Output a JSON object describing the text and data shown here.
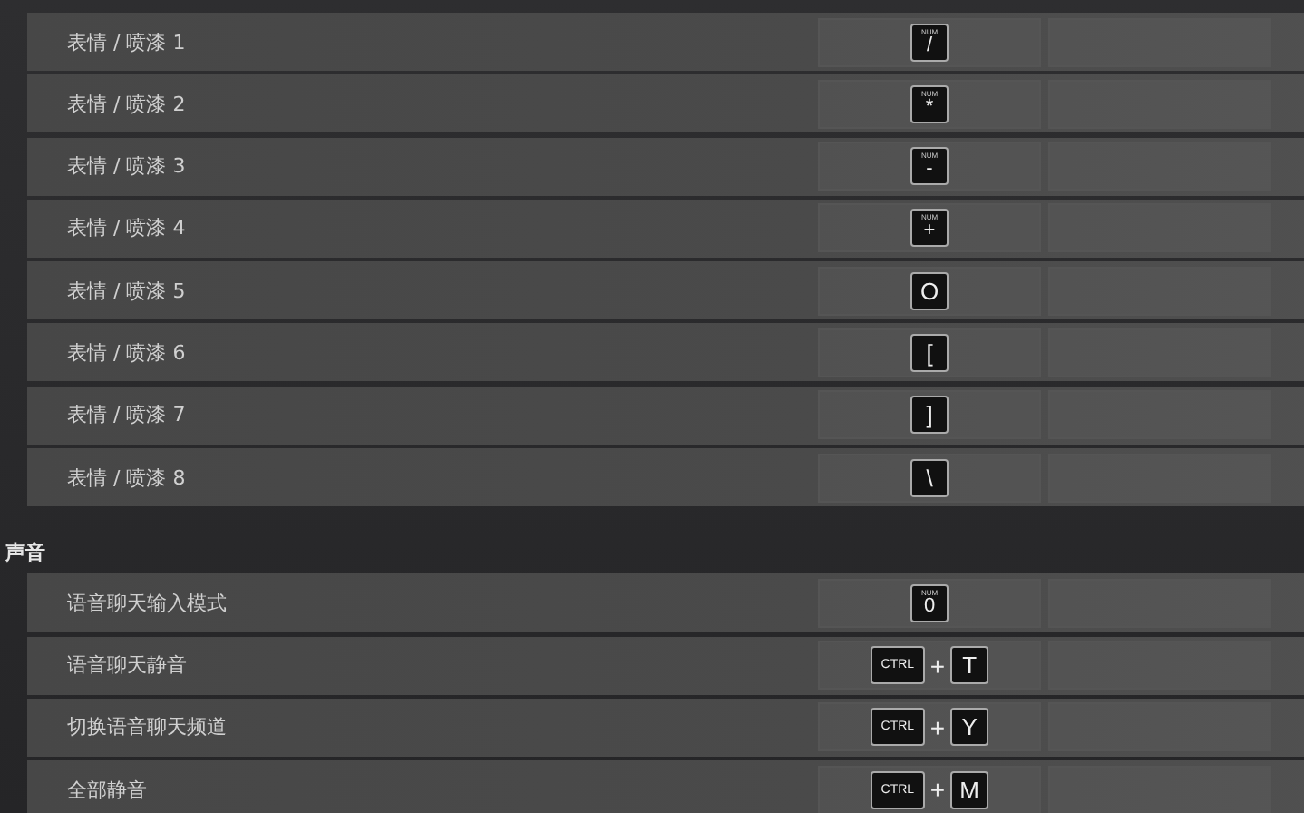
{
  "sections": [
    {
      "rows": [
        {
          "label": "表情 / 喷漆 1",
          "keys": [
            {
              "kind": "num",
              "top": "NUM",
              "label": "/"
            }
          ]
        },
        {
          "label": "表情 / 喷漆 2",
          "keys": [
            {
              "kind": "num",
              "top": "NUM",
              "label": "*"
            }
          ]
        },
        {
          "label": "表情 / 喷漆 3",
          "keys": [
            {
              "kind": "num",
              "top": "NUM",
              "label": "-"
            }
          ]
        },
        {
          "label": "表情 / 喷漆 4",
          "keys": [
            {
              "kind": "num",
              "top": "NUM",
              "label": "+"
            }
          ]
        },
        {
          "label": "表情 / 喷漆 5",
          "keys": [
            {
              "kind": "key",
              "label": "O"
            }
          ]
        },
        {
          "label": "表情 / 喷漆 6",
          "keys": [
            {
              "kind": "key",
              "label": "["
            }
          ]
        },
        {
          "label": "表情 / 喷漆 7",
          "keys": [
            {
              "kind": "key",
              "label": "]"
            }
          ]
        },
        {
          "label": "表情 / 喷漆 8",
          "keys": [
            {
              "kind": "key",
              "label": "\\"
            }
          ]
        }
      ]
    },
    {
      "title": "声音",
      "rows": [
        {
          "label": "语音聊天输入模式",
          "keys": [
            {
              "kind": "num",
              "top": "NUM",
              "label": "0"
            }
          ]
        },
        {
          "label": "语音聊天静音",
          "keys": [
            {
              "kind": "mod",
              "label": "CTRL"
            },
            {
              "kind": "plus",
              "label": "+"
            },
            {
              "kind": "key",
              "label": "T"
            }
          ]
        },
        {
          "label": "切换语音聊天频道",
          "keys": [
            {
              "kind": "mod",
              "label": "CTRL"
            },
            {
              "kind": "plus",
              "label": "+"
            },
            {
              "kind": "key",
              "label": "Y"
            }
          ]
        },
        {
          "label": "全部静音",
          "keys": [
            {
              "kind": "mod",
              "label": "CTRL"
            },
            {
              "kind": "plus",
              "label": "+"
            },
            {
              "kind": "key",
              "label": "M"
            }
          ]
        }
      ]
    }
  ]
}
